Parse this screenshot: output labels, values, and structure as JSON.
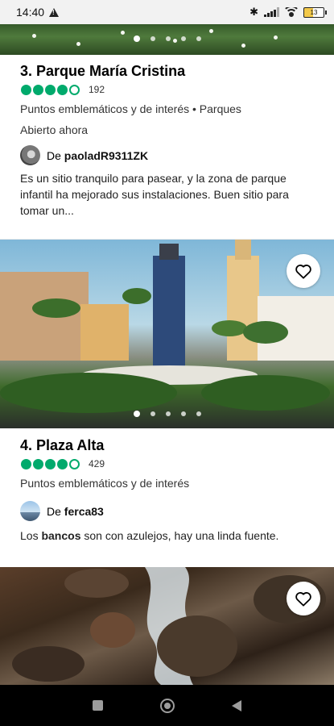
{
  "status_bar": {
    "time": "14:40",
    "battery": "13"
  },
  "listings": [
    {
      "title": "3. Parque María Cristina",
      "rating_bubbles": 4,
      "review_count": "192",
      "categories": "Puntos emblemáticos y de interés • Parques",
      "open_status": "Abierto ahora",
      "author_prefix": "De",
      "author": "paoladR9311ZK",
      "snippet": "Es un sitio tranquilo para pasear, y la zona de parque infantil ha mejorado sus instalaciones. Buen sitio para tomar un..."
    },
    {
      "title": "4. Plaza Alta",
      "rating_bubbles": 4,
      "review_count": "429",
      "categories": "Puntos emblemáticos y de interés",
      "author_prefix": "De",
      "author": "ferca83",
      "snippet_before": "Los ",
      "snippet_bold": "bancos",
      "snippet_after": " son con azulejos, hay una linda fuente."
    }
  ],
  "icons": {
    "favorite": "heart-icon",
    "nav_recents": "square-icon",
    "nav_home": "circle-icon",
    "nav_back": "triangle-back-icon"
  },
  "colors": {
    "rating_green": "#00aa6c"
  }
}
